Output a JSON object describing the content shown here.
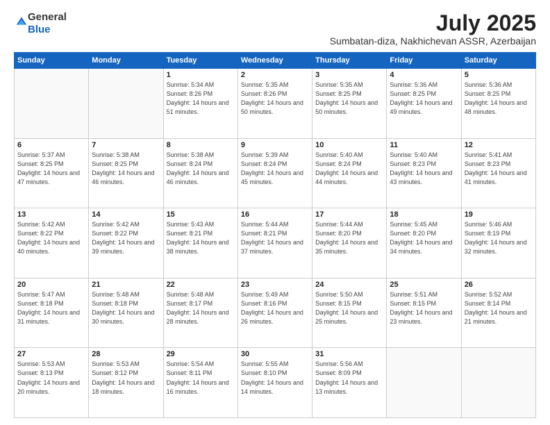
{
  "logo": {
    "general": "General",
    "blue": "Blue"
  },
  "title": "July 2025",
  "location": "Sumbatan-diza, Nakhichevan ASSR, Azerbaijan",
  "days_of_week": [
    "Sunday",
    "Monday",
    "Tuesday",
    "Wednesday",
    "Thursday",
    "Friday",
    "Saturday"
  ],
  "weeks": [
    [
      {
        "day": "",
        "info": ""
      },
      {
        "day": "",
        "info": ""
      },
      {
        "day": "1",
        "info": "Sunrise: 5:34 AM\nSunset: 8:26 PM\nDaylight: 14 hours and 51 minutes."
      },
      {
        "day": "2",
        "info": "Sunrise: 5:35 AM\nSunset: 8:26 PM\nDaylight: 14 hours and 50 minutes."
      },
      {
        "day": "3",
        "info": "Sunrise: 5:35 AM\nSunset: 8:25 PM\nDaylight: 14 hours and 50 minutes."
      },
      {
        "day": "4",
        "info": "Sunrise: 5:36 AM\nSunset: 8:25 PM\nDaylight: 14 hours and 49 minutes."
      },
      {
        "day": "5",
        "info": "Sunrise: 5:36 AM\nSunset: 8:25 PM\nDaylight: 14 hours and 48 minutes."
      }
    ],
    [
      {
        "day": "6",
        "info": "Sunrise: 5:37 AM\nSunset: 8:25 PM\nDaylight: 14 hours and 47 minutes."
      },
      {
        "day": "7",
        "info": "Sunrise: 5:38 AM\nSunset: 8:25 PM\nDaylight: 14 hours and 46 minutes."
      },
      {
        "day": "8",
        "info": "Sunrise: 5:38 AM\nSunset: 8:24 PM\nDaylight: 14 hours and 46 minutes."
      },
      {
        "day": "9",
        "info": "Sunrise: 5:39 AM\nSunset: 8:24 PM\nDaylight: 14 hours and 45 minutes."
      },
      {
        "day": "10",
        "info": "Sunrise: 5:40 AM\nSunset: 8:24 PM\nDaylight: 14 hours and 44 minutes."
      },
      {
        "day": "11",
        "info": "Sunrise: 5:40 AM\nSunset: 8:23 PM\nDaylight: 14 hours and 43 minutes."
      },
      {
        "day": "12",
        "info": "Sunrise: 5:41 AM\nSunset: 8:23 PM\nDaylight: 14 hours and 41 minutes."
      }
    ],
    [
      {
        "day": "13",
        "info": "Sunrise: 5:42 AM\nSunset: 8:22 PM\nDaylight: 14 hours and 40 minutes."
      },
      {
        "day": "14",
        "info": "Sunrise: 5:42 AM\nSunset: 8:22 PM\nDaylight: 14 hours and 39 minutes."
      },
      {
        "day": "15",
        "info": "Sunrise: 5:43 AM\nSunset: 8:21 PM\nDaylight: 14 hours and 38 minutes."
      },
      {
        "day": "16",
        "info": "Sunrise: 5:44 AM\nSunset: 8:21 PM\nDaylight: 14 hours and 37 minutes."
      },
      {
        "day": "17",
        "info": "Sunrise: 5:44 AM\nSunset: 8:20 PM\nDaylight: 14 hours and 35 minutes."
      },
      {
        "day": "18",
        "info": "Sunrise: 5:45 AM\nSunset: 8:20 PM\nDaylight: 14 hours and 34 minutes."
      },
      {
        "day": "19",
        "info": "Sunrise: 5:46 AM\nSunset: 8:19 PM\nDaylight: 14 hours and 32 minutes."
      }
    ],
    [
      {
        "day": "20",
        "info": "Sunrise: 5:47 AM\nSunset: 8:18 PM\nDaylight: 14 hours and 31 minutes."
      },
      {
        "day": "21",
        "info": "Sunrise: 5:48 AM\nSunset: 8:18 PM\nDaylight: 14 hours and 30 minutes."
      },
      {
        "day": "22",
        "info": "Sunrise: 5:48 AM\nSunset: 8:17 PM\nDaylight: 14 hours and 28 minutes."
      },
      {
        "day": "23",
        "info": "Sunrise: 5:49 AM\nSunset: 8:16 PM\nDaylight: 14 hours and 26 minutes."
      },
      {
        "day": "24",
        "info": "Sunrise: 5:50 AM\nSunset: 8:15 PM\nDaylight: 14 hours and 25 minutes."
      },
      {
        "day": "25",
        "info": "Sunrise: 5:51 AM\nSunset: 8:15 PM\nDaylight: 14 hours and 23 minutes."
      },
      {
        "day": "26",
        "info": "Sunrise: 5:52 AM\nSunset: 8:14 PM\nDaylight: 14 hours and 21 minutes."
      }
    ],
    [
      {
        "day": "27",
        "info": "Sunrise: 5:53 AM\nSunset: 8:13 PM\nDaylight: 14 hours and 20 minutes."
      },
      {
        "day": "28",
        "info": "Sunrise: 5:53 AM\nSunset: 8:12 PM\nDaylight: 14 hours and 18 minutes."
      },
      {
        "day": "29",
        "info": "Sunrise: 5:54 AM\nSunset: 8:11 PM\nDaylight: 14 hours and 16 minutes."
      },
      {
        "day": "30",
        "info": "Sunrise: 5:55 AM\nSunset: 8:10 PM\nDaylight: 14 hours and 14 minutes."
      },
      {
        "day": "31",
        "info": "Sunrise: 5:56 AM\nSunset: 8:09 PM\nDaylight: 14 hours and 13 minutes."
      },
      {
        "day": "",
        "info": ""
      },
      {
        "day": "",
        "info": ""
      }
    ]
  ]
}
